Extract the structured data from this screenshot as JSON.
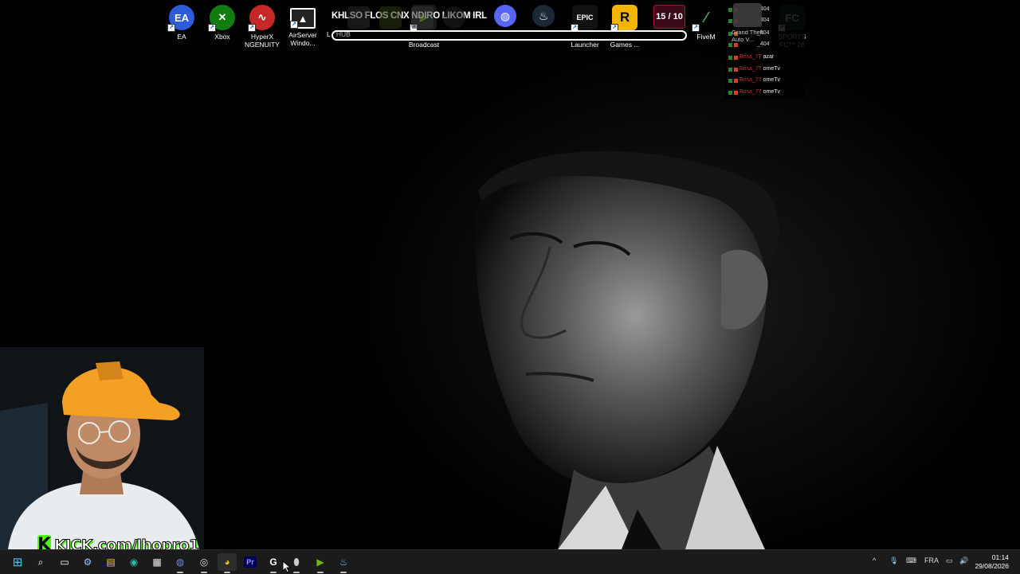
{
  "desktop": {
    "icons": [
      {
        "label": "EA",
        "icon": "ea-icon",
        "color": "#2e5bd9"
      },
      {
        "label": "Xbox",
        "icon": "xbox-icon",
        "color": "#107c10"
      },
      {
        "label": "HyperX\nNGENUITY",
        "icon": "hyperx-icon",
        "color": "#c62828"
      },
      {
        "label": "AirServer\nWindo...",
        "icon": "airserver-icon",
        "color": "#222222"
      },
      {
        "label": "Broadcast",
        "icon": "nvidia-broadcast-icon",
        "color": "#76b900"
      },
      {
        "label": "Launcher",
        "icon": "epic-games-icon",
        "color": "#111111"
      },
      {
        "label": "Games ...",
        "icon": "rockstar-icon",
        "color": "#f5b400"
      },
      {
        "label": "FiveM",
        "icon": "fivem-icon",
        "color": "#111111"
      },
      {
        "label": "SPORTS\nFC™ 26",
        "icon": "ea-fc-icon",
        "color": "#1d3b2a"
      }
    ],
    "hub_label": "HUB",
    "partial_label": "L"
  },
  "overlay": {
    "banner_text": "KHLSO FLOS CNX NDIRO LIKOM IRL",
    "goal": "15 / 10"
  },
  "log_panel": {
    "rows": [
      {
        "name": "",
        "msg": "_404"
      },
      {
        "name": "",
        "msg": "_404"
      },
      {
        "name": "",
        "msg": "_404"
      },
      {
        "name": "",
        "msg": "_404"
      },
      {
        "name": "Brisa_77",
        "msg": "azar"
      },
      {
        "name": "Brisa_77",
        "msg": "omeTv"
      },
      {
        "name": "Brisa_77",
        "msg": "omeTv"
      },
      {
        "name": "Brisa_77",
        "msg": "omeTv"
      }
    ],
    "gta_label": "Grand Theft\nAuto V..."
  },
  "webcam": {
    "kick_letter": "K",
    "kick_text": "KICK.com/lhopro1"
  },
  "taskbar": {
    "items": [
      {
        "icon": "windows-start-icon",
        "glyph": "⊞"
      },
      {
        "icon": "search-icon",
        "glyph": "⌕"
      },
      {
        "icon": "task-view-icon",
        "glyph": "▭"
      },
      {
        "icon": "settings-icon",
        "glyph": "⚙"
      },
      {
        "icon": "file-explorer-icon",
        "glyph": "▤"
      },
      {
        "icon": "edge-icon",
        "glyph": "◉"
      },
      {
        "icon": "store-icon",
        "glyph": "▦"
      },
      {
        "icon": "discord-icon",
        "glyph": "◍"
      },
      {
        "icon": "obs-icon",
        "glyph": "◎"
      },
      {
        "icon": "chrome-icon",
        "glyph": "◕"
      },
      {
        "icon": "premiere-icon",
        "glyph": "Pr"
      },
      {
        "icon": "logitech-icon",
        "glyph": "G"
      },
      {
        "icon": "mouse-app-icon",
        "glyph": "⬮"
      },
      {
        "icon": "nvidia-broadcast-icon",
        "glyph": "▶"
      },
      {
        "icon": "steam-icon",
        "glyph": "♨"
      }
    ],
    "tray": {
      "language": "FRA",
      "time": "01:14",
      "date": "29/08/2026"
    }
  }
}
